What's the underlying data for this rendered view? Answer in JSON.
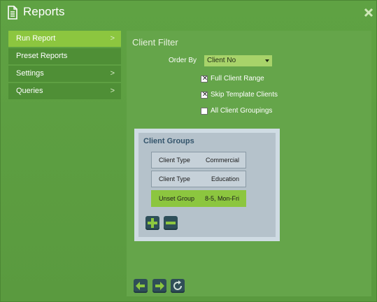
{
  "window": {
    "title": "Reports",
    "title_icon": "document-icon",
    "close_icon": "close-icon"
  },
  "sidebar": {
    "items": [
      {
        "label": "Run Report",
        "chevron": ">"
      },
      {
        "label": "Preset Reports",
        "chevron": ""
      },
      {
        "label": "Settings",
        "chevron": ">"
      },
      {
        "label": "Queries",
        "chevron": ">"
      }
    ]
  },
  "main": {
    "title": "Client Filter",
    "order_by": {
      "label": "Order By",
      "value": "Client No"
    },
    "checks": [
      {
        "label": "Full Client Range",
        "checked": true,
        "mark": "✕"
      },
      {
        "label": "Skip Template Clients",
        "checked": true,
        "mark": "✕"
      },
      {
        "label": "All Client Groupings",
        "checked": false,
        "mark": ""
      }
    ],
    "groups": {
      "title": "Client Groups",
      "rows": [
        {
          "label": "Client Type",
          "value": "Commercial"
        },
        {
          "label": "Client Type",
          "value": "Education"
        },
        {
          "label": "Unset Group",
          "value": "8-5, Mon-Fri"
        }
      ],
      "add_icon": "plus-icon",
      "remove_icon": "minus-icon"
    }
  },
  "nav": {
    "back_icon": "arrow-left-icon",
    "forward_icon": "arrow-right-icon",
    "refresh_icon": "refresh-icon"
  },
  "colors": {
    "accent": "#8cc63f",
    "background": "#5a9a3f",
    "panel": "#65a54a"
  }
}
